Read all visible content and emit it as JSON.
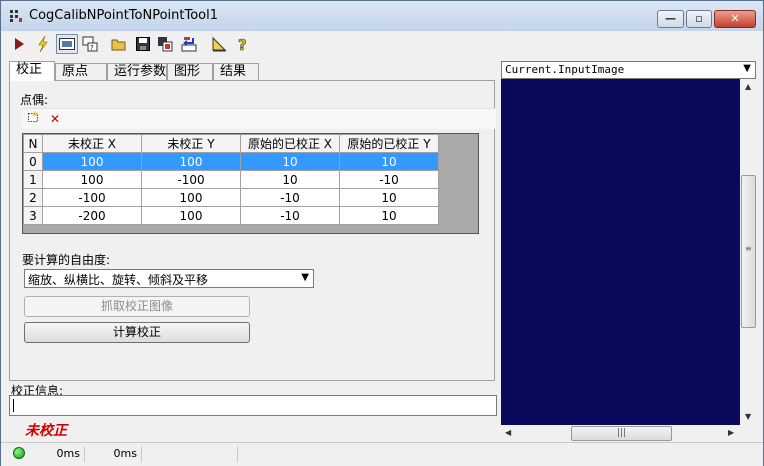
{
  "window": {
    "title": "CogCalibNPointToNPointTool1",
    "min_label": "—",
    "max_label": "▫",
    "close_label": "✕"
  },
  "toolbar": {
    "icons": [
      "run-icon",
      "lightning-icon",
      "toggle-view-icon",
      "window-icon",
      "open-folder-icon",
      "save-icon",
      "save-as-icon",
      "reset-icon",
      "layout-icon",
      "help-icon"
    ]
  },
  "tabs": [
    "校正",
    "原点",
    "运行参数",
    "图形",
    "结果"
  ],
  "calibration": {
    "points_label": "点偶:",
    "table": {
      "headers": [
        "N",
        "未校正 X",
        "未校正 Y",
        "原始的已校正 X",
        "原始的已校正 Y"
      ],
      "rows": [
        [
          "0",
          "100",
          "100",
          "10",
          "10"
        ],
        [
          "1",
          "100",
          "-100",
          "10",
          "-10"
        ],
        [
          "2",
          "-100",
          "100",
          "-10",
          "10"
        ],
        [
          "3",
          "-200",
          "100",
          "-10",
          "10"
        ]
      ],
      "selected_row": 0
    },
    "dof_label": "要计算的自由度:",
    "dof_value": "缩放、纵横比、旋转、倾斜及平移",
    "grab_button": "抓取校正图像",
    "compute_button": "计算校正"
  },
  "info": {
    "label": "校正信息:",
    "value": "",
    "status": "未校正"
  },
  "statusbar": {
    "time1": "0ms",
    "time2": "0ms",
    "status_color": "#11a011"
  },
  "display": {
    "image_selector": "Current.InputImage",
    "background": "#0a0a5c"
  }
}
